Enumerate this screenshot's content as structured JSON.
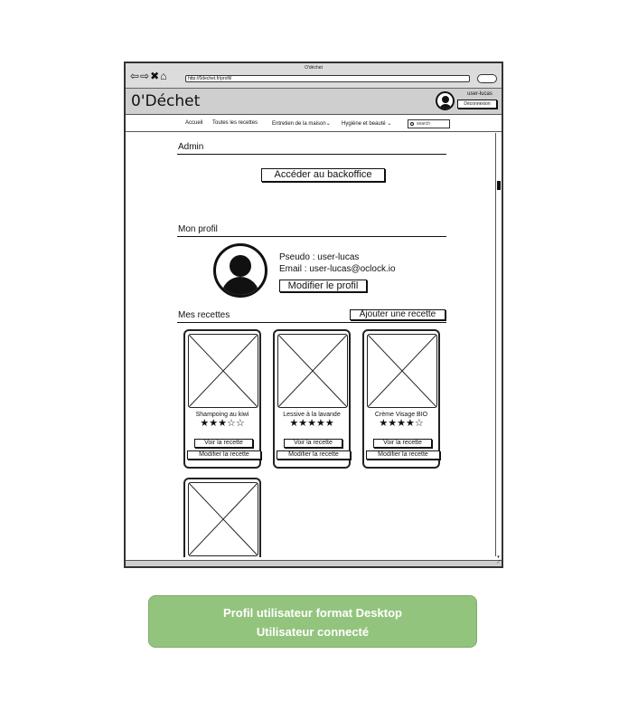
{
  "browser": {
    "title": "O'déchet",
    "url": "http://0dechet.fr/profil/"
  },
  "header": {
    "logo": "0'Déchet",
    "username": "user-lucas",
    "logout_label": "Déconnexion"
  },
  "nav": {
    "items": [
      "Accueil",
      "Toutes les recettes",
      "Entretien de la maison",
      "Hygiène et beauté"
    ],
    "search_placeholder": "search"
  },
  "admin": {
    "title": "Admin",
    "backoffice_label": "Accéder au backoffice"
  },
  "profile": {
    "title": "Mon profil",
    "pseudo": "Pseudo : user-lucas",
    "email": "Email : user-lucas@oclock.io",
    "edit_label": "Modifier le profil"
  },
  "recipes": {
    "title": "Mes recettes",
    "add_label": "Ajouter une recette",
    "view_label": "Voir la recette",
    "edit_label": "Modifier la recette",
    "items": [
      {
        "name": "Shampoing au kiwi",
        "rating": 3,
        "max": 5
      },
      {
        "name": "Lessive à la lavande",
        "rating": 5,
        "max": 5
      },
      {
        "name": "Crème Visage BIO",
        "rating": 4,
        "max": 5
      },
      {
        "name": "",
        "rating": 0,
        "max": 5
      }
    ]
  },
  "caption": {
    "line1": "Profil utilisateur format Desktop",
    "line2": "Utilisateur connecté"
  },
  "colors": {
    "caption_bg": "#93c47d",
    "chrome_bg": "#cfcfcf"
  },
  "icons": [
    "back-arrow-icon",
    "forward-arrow-icon",
    "close-icon",
    "home-icon",
    "search-icon",
    "avatar-icon",
    "image-placeholder-icon",
    "star-icon",
    "resize-grip-icon"
  ]
}
